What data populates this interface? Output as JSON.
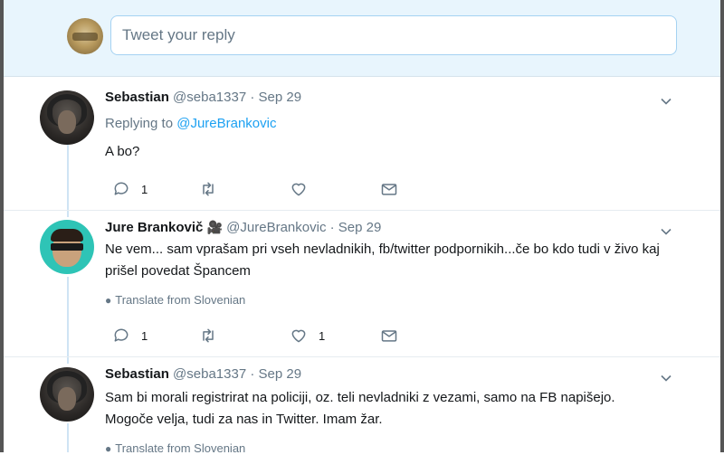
{
  "composer": {
    "placeholder": "Tweet your reply",
    "avatar": "user-avatar"
  },
  "tweets": [
    {
      "name": "Sebastian",
      "handle": "@seba1337",
      "separator": "·",
      "date": "Sep 29",
      "replying_prefix": "Replying to",
      "replying_to": "@JureBrankovic",
      "text": "A bo?",
      "reply_count": "1",
      "retweet_count": "",
      "like_count": ""
    },
    {
      "name": "Jure Brankovič",
      "badge_icon": "movie-camera-icon",
      "badge": "🎥",
      "handle": "@JureBrankovic",
      "separator": "·",
      "date": "Sep 29",
      "text": "Ne vem... sam vprašam pri vseh nevladnikih, fb/twitter podpornikih...če bo kdo tudi v živo kaj prišel povedat Špancem",
      "translate": "Translate from Slovenian",
      "reply_count": "1",
      "retweet_count": "",
      "like_count": "1"
    },
    {
      "name": "Sebastian",
      "handle": "@seba1337",
      "separator": "·",
      "date": "Sep 29",
      "text": "Sam bi morali registrirat na policiji, oz. teli nevladniki z vezami, samo na FB napišejo. Mogoče velja, tudi za nas in Twitter. Imam žar.",
      "translate": "Translate from Slovenian"
    }
  ],
  "colors": {
    "accent": "#1da1f2",
    "muted": "#657786",
    "composer_bg": "#e8f5fd",
    "thread_line": "#cfe4f4"
  }
}
